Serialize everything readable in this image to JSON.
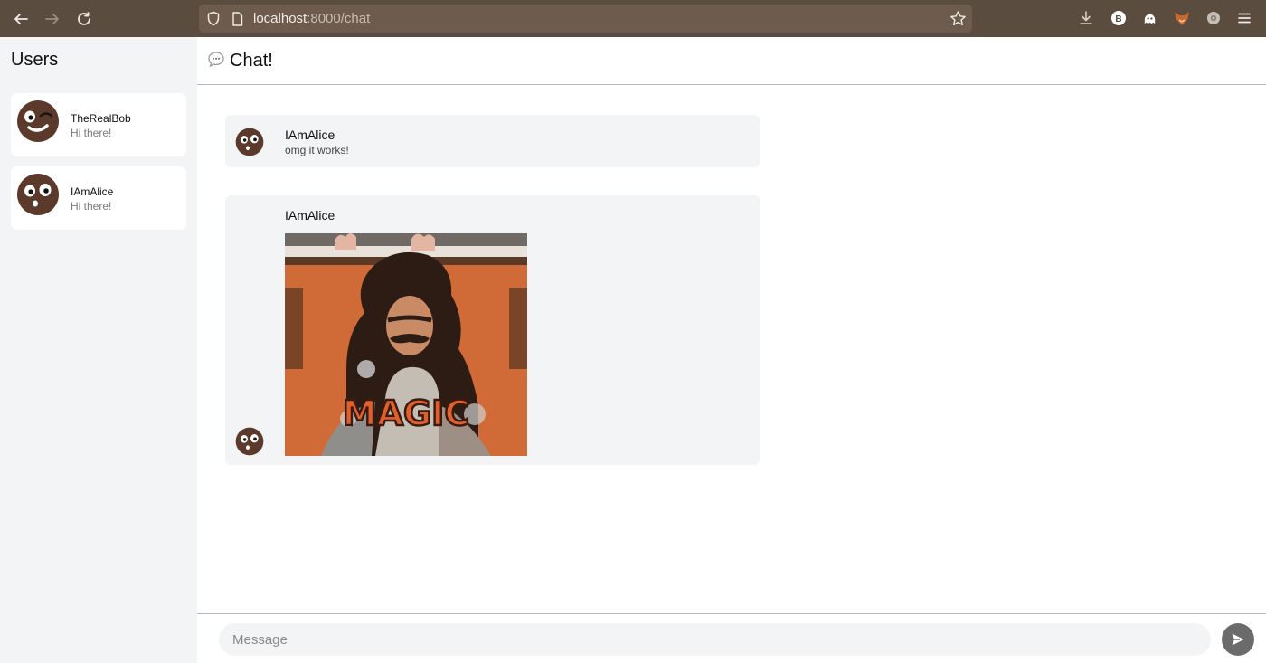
{
  "browser": {
    "url_host": "localhost",
    "url_path": ":8000/chat"
  },
  "sidebar": {
    "title": "Users",
    "users": [
      {
        "name": "TheRealBob",
        "last_message": "Hi there!"
      },
      {
        "name": "IAmAlice",
        "last_message": "Hi there!"
      }
    ]
  },
  "chat": {
    "title": "Chat!",
    "messages": [
      {
        "author": "IAmAlice",
        "text": "omg it works!"
      },
      {
        "author": "IAmAlice",
        "gif_caption": "MAGIC"
      }
    ]
  },
  "composer": {
    "placeholder": "Message"
  },
  "colors": {
    "toolbar": "#5b4c40",
    "sidebar": "#f3f4f6",
    "bubble": "#f3f4f6",
    "send_button": "#6b6b6b"
  },
  "icons": [
    "back-icon",
    "forward-icon",
    "reload-icon",
    "shield-icon",
    "page-icon",
    "star-icon",
    "download-icon",
    "extension-b-icon",
    "extension-ghost-icon",
    "extension-fox-icon",
    "extension-gear-icon",
    "menu-icon",
    "chat-bubble-icon",
    "send-icon"
  ]
}
